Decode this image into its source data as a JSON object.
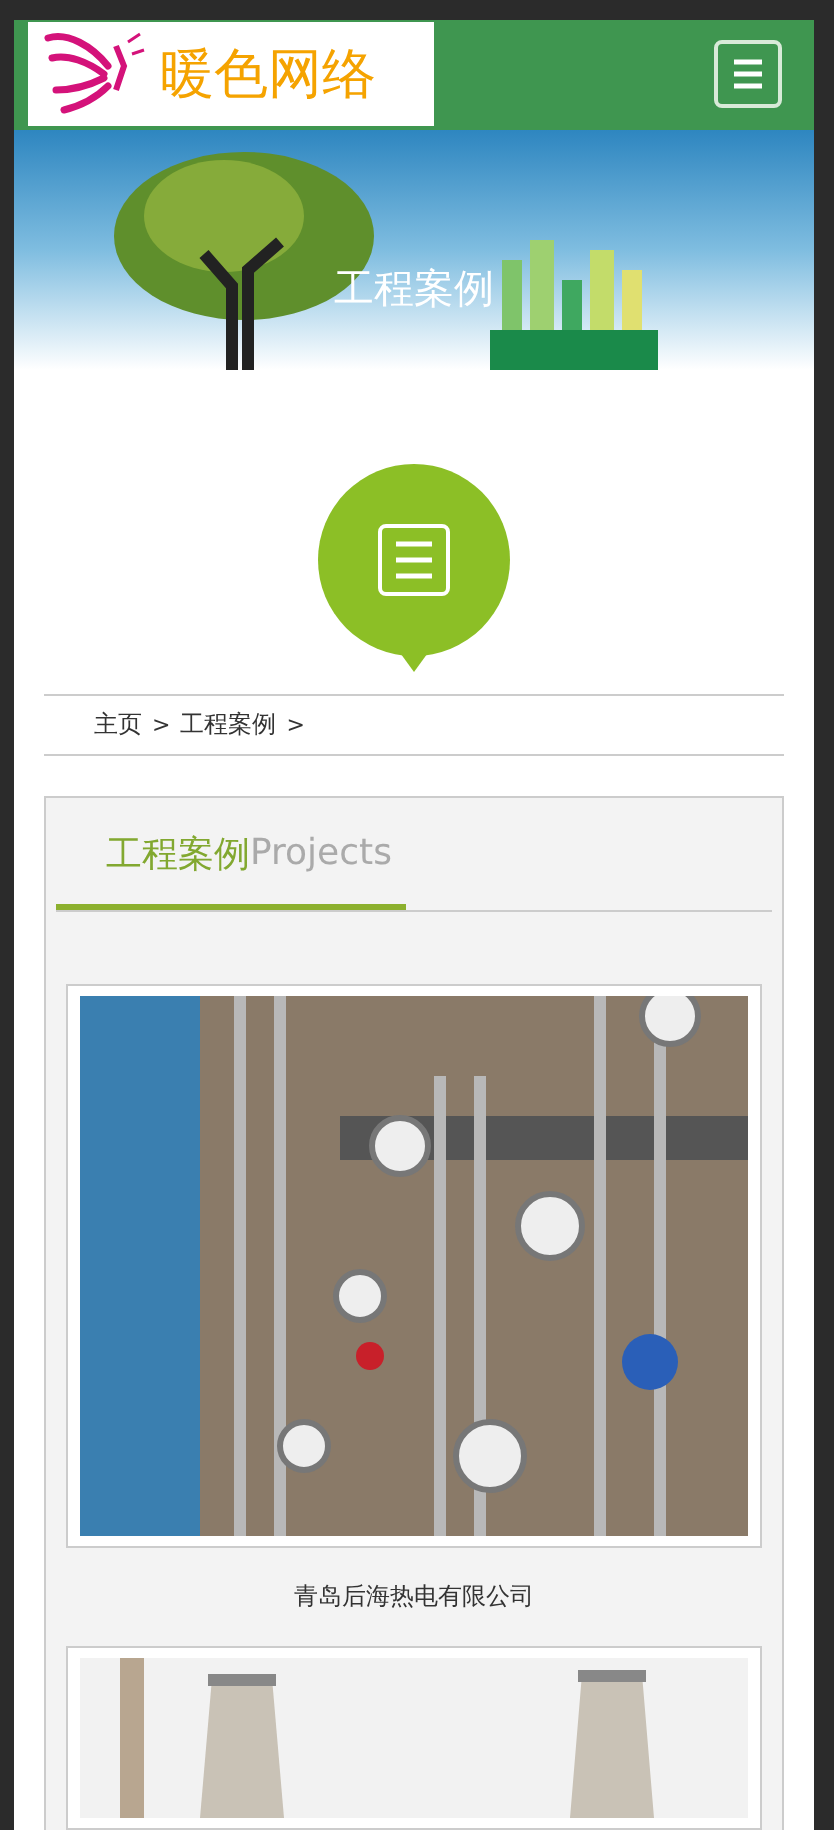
{
  "header": {
    "logo_text": "暖色网络"
  },
  "banner": {
    "title": "工程案例"
  },
  "breadcrumb": {
    "separator": ">",
    "items": [
      {
        "label": "主页"
      },
      {
        "label": "工程案例"
      }
    ]
  },
  "section": {
    "title": "工程案例",
    "subtitle": "Projects"
  },
  "cases": [
    {
      "caption": "青岛后海热电有限公司",
      "kind": "gauges"
    },
    {
      "kind": "chimneys"
    }
  ]
}
